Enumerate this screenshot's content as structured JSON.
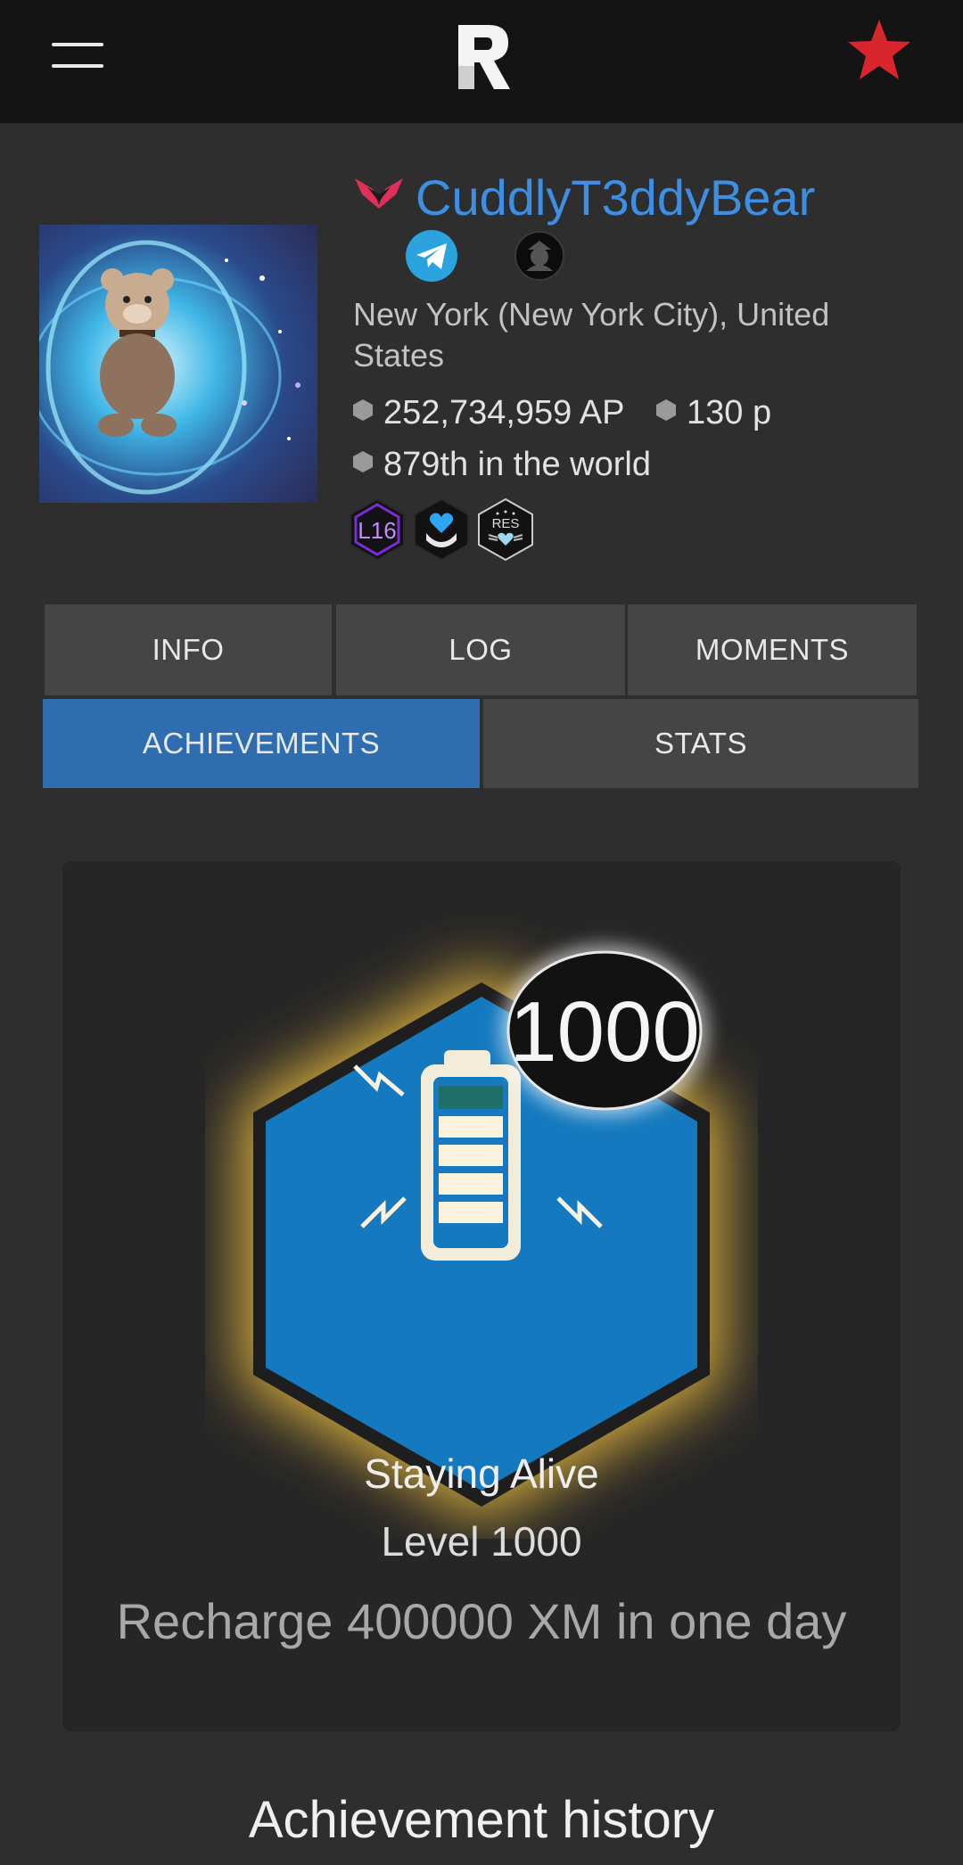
{
  "header": {
    "menu_icon": "hamburger-menu-icon",
    "logo_icon": "ingress-r-logo",
    "favorite_icon": "star-icon",
    "favorite_color": "#d8262c"
  },
  "profile": {
    "username": "CuddlyT3ddyBear",
    "username_color": "#3d8fe6",
    "faction_icon": "faction-wings-icon",
    "location": "New York (New York City), United States",
    "ap": "252,734,959 AP",
    "points": "130 p",
    "rank": "879th in the world",
    "badges": [
      {
        "label": "L16",
        "icon": "level-badge"
      },
      {
        "label": "",
        "icon": "heart-hands-badge"
      },
      {
        "label": "RES",
        "icon": "resistance-badge"
      }
    ]
  },
  "tabs": [
    {
      "label": "INFO"
    },
    {
      "label": "LOG"
    },
    {
      "label": "MOMENTS"
    },
    {
      "label": "ACHIEVEMENTS",
      "active": true
    },
    {
      "label": "STATS"
    }
  ],
  "achievement": {
    "count": "1000",
    "title": "Staying Alive",
    "level": "Level 1000",
    "description": "Recharge 400000 XM in one day",
    "icon": "battery-recharge-icon",
    "accent": "#1479be",
    "glow": "#f0c040"
  },
  "history_title": "Achievement history"
}
